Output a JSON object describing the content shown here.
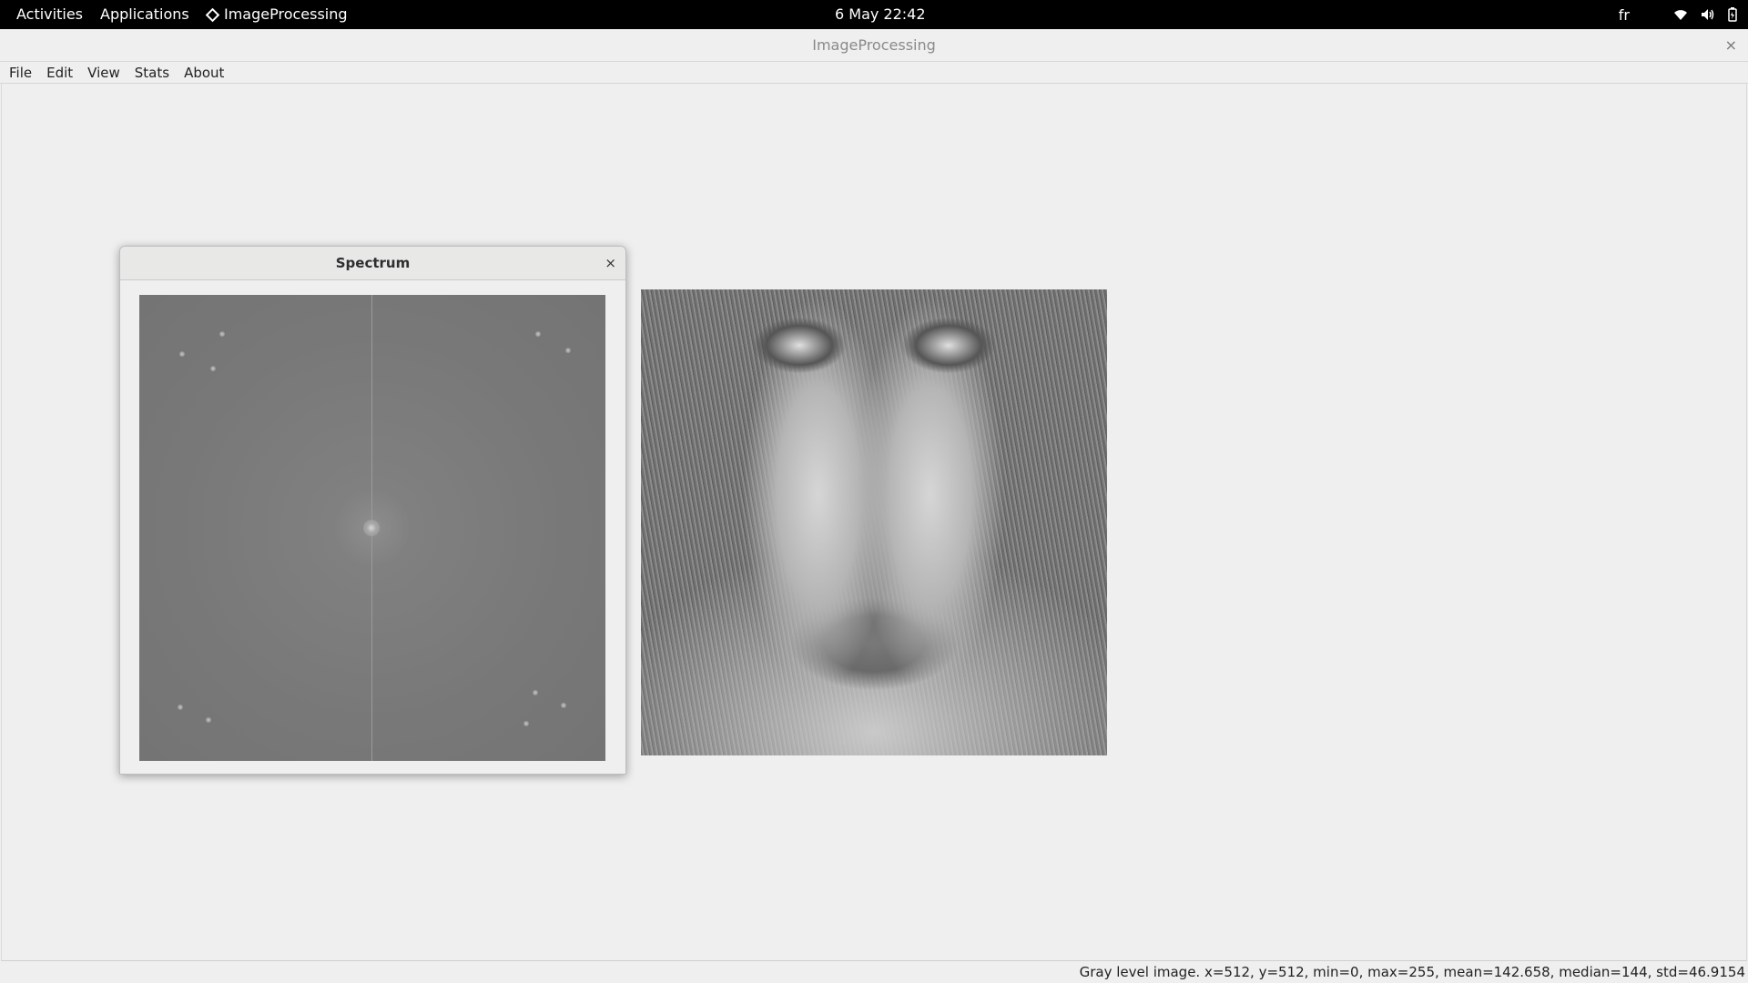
{
  "topbar": {
    "activities": "Activities",
    "applications": "Applications",
    "app_name": "ImageProcessing",
    "clock": "6 May  22:42",
    "keyboard_layout": "fr",
    "icons": [
      "wifi-icon",
      "volume-icon",
      "battery-icon"
    ]
  },
  "window": {
    "title": "ImageProcessing",
    "close": "×"
  },
  "menubar": {
    "items": [
      "File",
      "Edit",
      "View",
      "Stats",
      "About"
    ]
  },
  "dialog": {
    "title": "Spectrum",
    "close": "×"
  },
  "statusbar": {
    "text": "Gray level image. x=512, y=512, min=0, max=255, mean=142.658, median=144, std=46.9154"
  },
  "colors": {
    "topbar_bg": "#000000",
    "window_bg": "#efefef",
    "dialog_header_bg": "#e8e8e7"
  }
}
